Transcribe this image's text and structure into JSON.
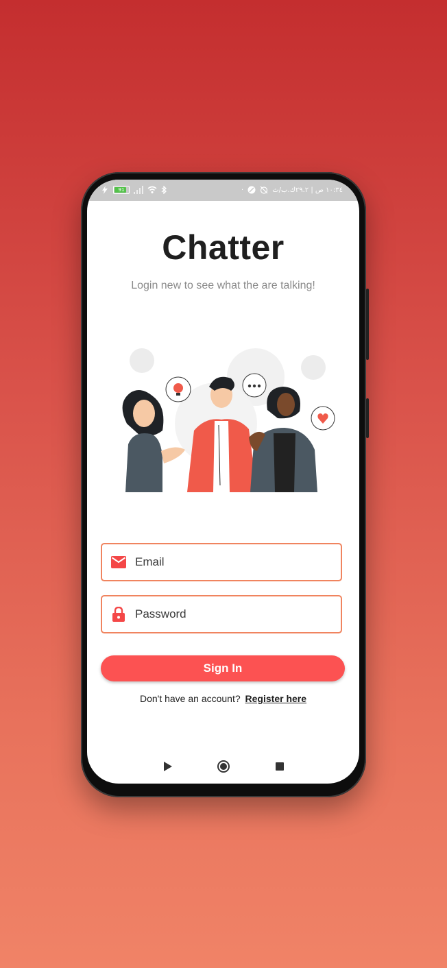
{
  "status_bar": {
    "battery": "91",
    "time_text": "١٠:٣٤ ص | ٢٩.٢ك.ب/ث"
  },
  "app": {
    "title": "Chatter",
    "subtitle": "Login new to see what the are talking!"
  },
  "form": {
    "email_placeholder": "Email",
    "password_placeholder": "Password",
    "signin_label": "Sign In",
    "register_prompt": "Don't have an account?",
    "register_link": "Register here"
  },
  "colors": {
    "accent": "#fc5252",
    "field_border": "#f0845f",
    "icon": "#f44747"
  },
  "icons": {
    "email": "mail-icon",
    "password": "lock-icon",
    "nav_back": "play-back-icon",
    "nav_home": "home-circle-icon",
    "nav_recent": "square-recent-icon"
  }
}
